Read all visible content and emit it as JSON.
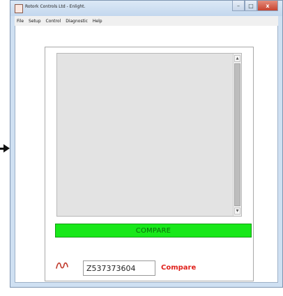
{
  "window": {
    "title": "Rotork Controls Ltd - Enlight.",
    "controls": {
      "minimize_icon": "minimize-icon",
      "maximize_icon": "maximize-icon",
      "close_label": "x"
    }
  },
  "menu": {
    "items": [
      "File",
      "Setup",
      "Control",
      "Diagnostic",
      "Help"
    ]
  },
  "main": {
    "output_text": "",
    "compare_bar_label": "COMPARE",
    "serial_value": "Z537373604",
    "compare_link_label": "Compare"
  },
  "colors": {
    "compare_bar": "#18e81a",
    "compare_link": "#e0201b",
    "wave_icon": "#c0392b"
  }
}
